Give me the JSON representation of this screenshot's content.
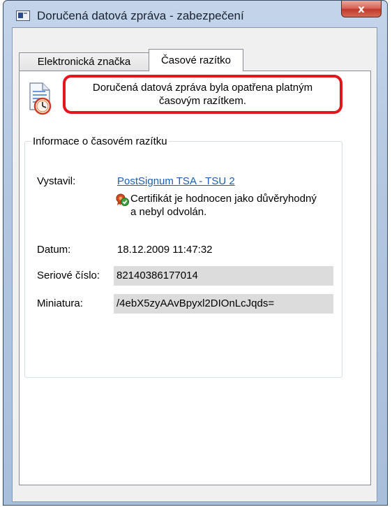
{
  "window": {
    "title": "Doručená datová zpráva - zabezpečení",
    "close_label": "x"
  },
  "tabs": [
    {
      "label": "Elektronická značka",
      "selected": false
    },
    {
      "label": "Časové razítko",
      "selected": true
    }
  ],
  "notice": {
    "line1": "Doručená datová zpráva byla opatřena platným",
    "line2": "časovým razítkem."
  },
  "timestamp_info": {
    "group_title": "Informace o časovém razítku",
    "issuer_label": "Vystavil:",
    "issuer_value": "PostSignum TSA - TSU 2",
    "cert_status_line1": "Certifikát je hodnocen jako důvěryhodný",
    "cert_status_line2": "a nebyl odvolán.",
    "date_label": "Datum:",
    "date_value": "18.12.2009 11:47:32",
    "serial_label": "Seriové číslo:",
    "serial_value": "82140386177014",
    "thumbprint_label": "Miniatura:",
    "thumbprint_value": "/4ebX5zyAAvBpyxl2DIOnLcJqds="
  },
  "colors": {
    "highlight_border": "#e4151b",
    "link": "#1a5fb4",
    "field_background": "#dcdcdc"
  },
  "icons": [
    "window-app-icon",
    "close-icon",
    "document-clock-icon",
    "certificate-check-icon"
  ]
}
